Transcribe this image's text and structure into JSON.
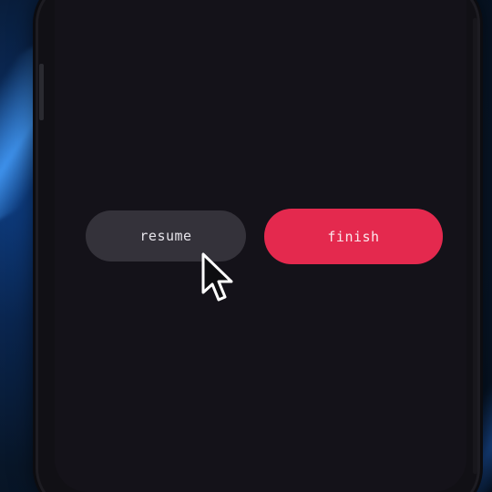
{
  "dialog": {
    "resume_label": "resume",
    "finish_label": "finish"
  },
  "colors": {
    "screen_background": "#141219",
    "resume_button": "#34323a",
    "finish_button": "#e4294e",
    "wallpaper_accent": "#1e6fe0"
  },
  "icons": {
    "cursor": "mouse-pointer-icon"
  }
}
